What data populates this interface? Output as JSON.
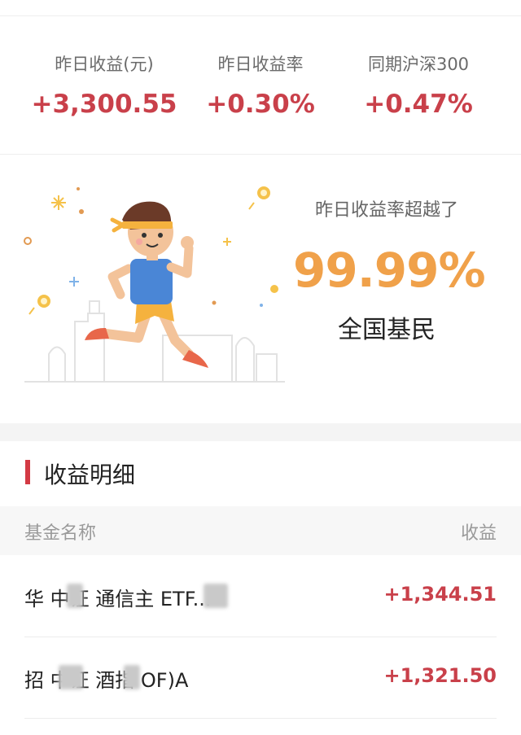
{
  "stats": [
    {
      "label": "昨日收益(元)",
      "value": "+3,300.55"
    },
    {
      "label": "昨日收益率",
      "value": "+0.30%"
    },
    {
      "label": "同期沪深300",
      "value": "+0.47%"
    }
  ],
  "hero": {
    "subtitle": "昨日收益率超越了",
    "percent": "99.99%",
    "desc": "全国基民"
  },
  "detail": {
    "title": "收益明细",
    "col_name": "基金名称",
    "col_gain": "收益",
    "rows": [
      {
        "name": "华 中证 通信主 ETF...",
        "gain": "+1,344.51"
      },
      {
        "name": "招 中证 酒指 OF)A",
        "gain": "+1,321.50"
      }
    ]
  },
  "colors": {
    "accent_red": "#c9404a",
    "gold": "#f0a14a"
  }
}
